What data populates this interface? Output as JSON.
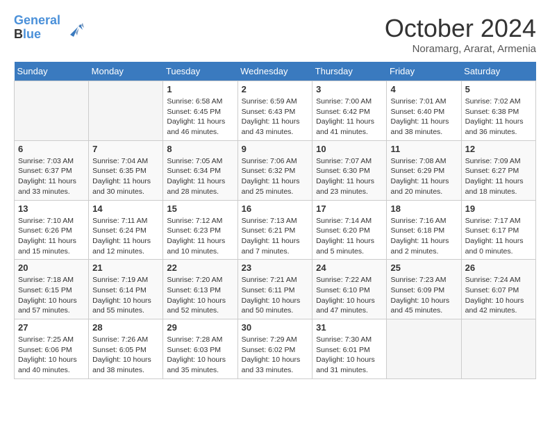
{
  "logo": {
    "line1": "General",
    "line2": "Blue"
  },
  "title": "October 2024",
  "location": "Noramarg, Ararat, Armenia",
  "weekdays": [
    "Sunday",
    "Monday",
    "Tuesday",
    "Wednesday",
    "Thursday",
    "Friday",
    "Saturday"
  ],
  "weeks": [
    [
      {
        "day": "",
        "info": ""
      },
      {
        "day": "",
        "info": ""
      },
      {
        "day": "1",
        "info": "Sunrise: 6:58 AM\nSunset: 6:45 PM\nDaylight: 11 hours and 46 minutes."
      },
      {
        "day": "2",
        "info": "Sunrise: 6:59 AM\nSunset: 6:43 PM\nDaylight: 11 hours and 43 minutes."
      },
      {
        "day": "3",
        "info": "Sunrise: 7:00 AM\nSunset: 6:42 PM\nDaylight: 11 hours and 41 minutes."
      },
      {
        "day": "4",
        "info": "Sunrise: 7:01 AM\nSunset: 6:40 PM\nDaylight: 11 hours and 38 minutes."
      },
      {
        "day": "5",
        "info": "Sunrise: 7:02 AM\nSunset: 6:38 PM\nDaylight: 11 hours and 36 minutes."
      }
    ],
    [
      {
        "day": "6",
        "info": "Sunrise: 7:03 AM\nSunset: 6:37 PM\nDaylight: 11 hours and 33 minutes."
      },
      {
        "day": "7",
        "info": "Sunrise: 7:04 AM\nSunset: 6:35 PM\nDaylight: 11 hours and 30 minutes."
      },
      {
        "day": "8",
        "info": "Sunrise: 7:05 AM\nSunset: 6:34 PM\nDaylight: 11 hours and 28 minutes."
      },
      {
        "day": "9",
        "info": "Sunrise: 7:06 AM\nSunset: 6:32 PM\nDaylight: 11 hours and 25 minutes."
      },
      {
        "day": "10",
        "info": "Sunrise: 7:07 AM\nSunset: 6:30 PM\nDaylight: 11 hours and 23 minutes."
      },
      {
        "day": "11",
        "info": "Sunrise: 7:08 AM\nSunset: 6:29 PM\nDaylight: 11 hours and 20 minutes."
      },
      {
        "day": "12",
        "info": "Sunrise: 7:09 AM\nSunset: 6:27 PM\nDaylight: 11 hours and 18 minutes."
      }
    ],
    [
      {
        "day": "13",
        "info": "Sunrise: 7:10 AM\nSunset: 6:26 PM\nDaylight: 11 hours and 15 minutes."
      },
      {
        "day": "14",
        "info": "Sunrise: 7:11 AM\nSunset: 6:24 PM\nDaylight: 11 hours and 12 minutes."
      },
      {
        "day": "15",
        "info": "Sunrise: 7:12 AM\nSunset: 6:23 PM\nDaylight: 11 hours and 10 minutes."
      },
      {
        "day": "16",
        "info": "Sunrise: 7:13 AM\nSunset: 6:21 PM\nDaylight: 11 hours and 7 minutes."
      },
      {
        "day": "17",
        "info": "Sunrise: 7:14 AM\nSunset: 6:20 PM\nDaylight: 11 hours and 5 minutes."
      },
      {
        "day": "18",
        "info": "Sunrise: 7:16 AM\nSunset: 6:18 PM\nDaylight: 11 hours and 2 minutes."
      },
      {
        "day": "19",
        "info": "Sunrise: 7:17 AM\nSunset: 6:17 PM\nDaylight: 11 hours and 0 minutes."
      }
    ],
    [
      {
        "day": "20",
        "info": "Sunrise: 7:18 AM\nSunset: 6:15 PM\nDaylight: 10 hours and 57 minutes."
      },
      {
        "day": "21",
        "info": "Sunrise: 7:19 AM\nSunset: 6:14 PM\nDaylight: 10 hours and 55 minutes."
      },
      {
        "day": "22",
        "info": "Sunrise: 7:20 AM\nSunset: 6:13 PM\nDaylight: 10 hours and 52 minutes."
      },
      {
        "day": "23",
        "info": "Sunrise: 7:21 AM\nSunset: 6:11 PM\nDaylight: 10 hours and 50 minutes."
      },
      {
        "day": "24",
        "info": "Sunrise: 7:22 AM\nSunset: 6:10 PM\nDaylight: 10 hours and 47 minutes."
      },
      {
        "day": "25",
        "info": "Sunrise: 7:23 AM\nSunset: 6:09 PM\nDaylight: 10 hours and 45 minutes."
      },
      {
        "day": "26",
        "info": "Sunrise: 7:24 AM\nSunset: 6:07 PM\nDaylight: 10 hours and 42 minutes."
      }
    ],
    [
      {
        "day": "27",
        "info": "Sunrise: 7:25 AM\nSunset: 6:06 PM\nDaylight: 10 hours and 40 minutes."
      },
      {
        "day": "28",
        "info": "Sunrise: 7:26 AM\nSunset: 6:05 PM\nDaylight: 10 hours and 38 minutes."
      },
      {
        "day": "29",
        "info": "Sunrise: 7:28 AM\nSunset: 6:03 PM\nDaylight: 10 hours and 35 minutes."
      },
      {
        "day": "30",
        "info": "Sunrise: 7:29 AM\nSunset: 6:02 PM\nDaylight: 10 hours and 33 minutes."
      },
      {
        "day": "31",
        "info": "Sunrise: 7:30 AM\nSunset: 6:01 PM\nDaylight: 10 hours and 31 minutes."
      },
      {
        "day": "",
        "info": ""
      },
      {
        "day": "",
        "info": ""
      }
    ]
  ]
}
